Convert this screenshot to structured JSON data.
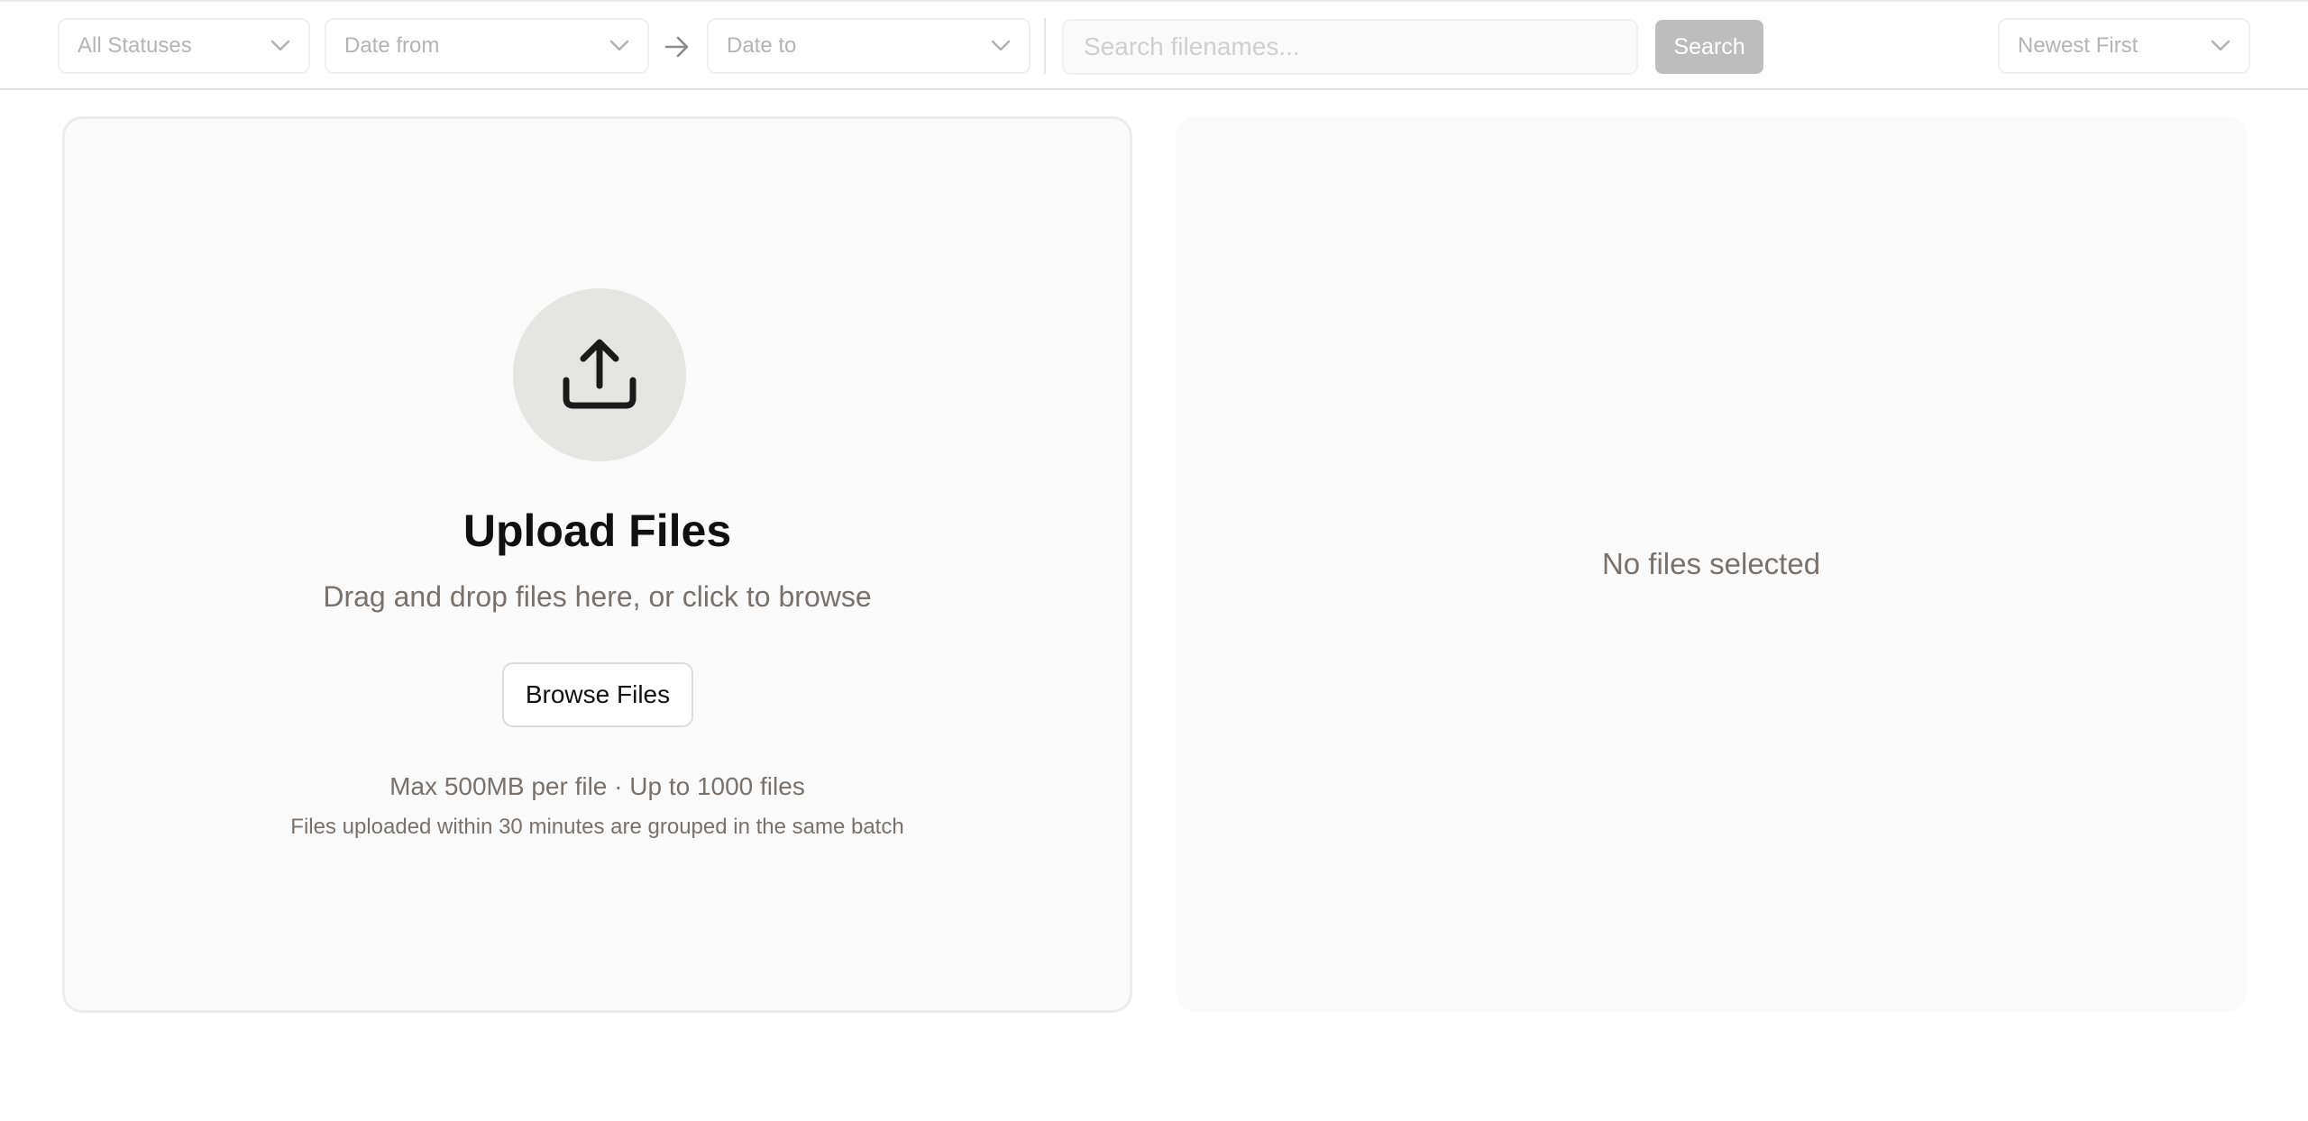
{
  "filters": {
    "status_label": "All Statuses",
    "date_from_label": "Date from",
    "date_to_label": "Date to",
    "sort_label": "Newest First"
  },
  "search": {
    "placeholder": "Search filenames...",
    "value": "",
    "button_label": "Search"
  },
  "upload": {
    "title": "Upload Files",
    "subtitle": "Drag and drop files here, or click to browse",
    "browse_label": "Browse Files",
    "limits": "Max 500MB per file · Up to 1000 files",
    "batch_note": "Files uploaded within 30 minutes are grouped in the same batch"
  },
  "files": {
    "empty_text": "No files selected"
  },
  "icons": {
    "upload": "upload-icon",
    "chevron": "chevron-down-icon",
    "date_range": "arrow-right-icon"
  },
  "colors": {
    "muted_text": "#78716c",
    "search_button": "#bdbdbd",
    "icon_circle": "#e5e5e4",
    "panel_background": "#fafafa"
  }
}
